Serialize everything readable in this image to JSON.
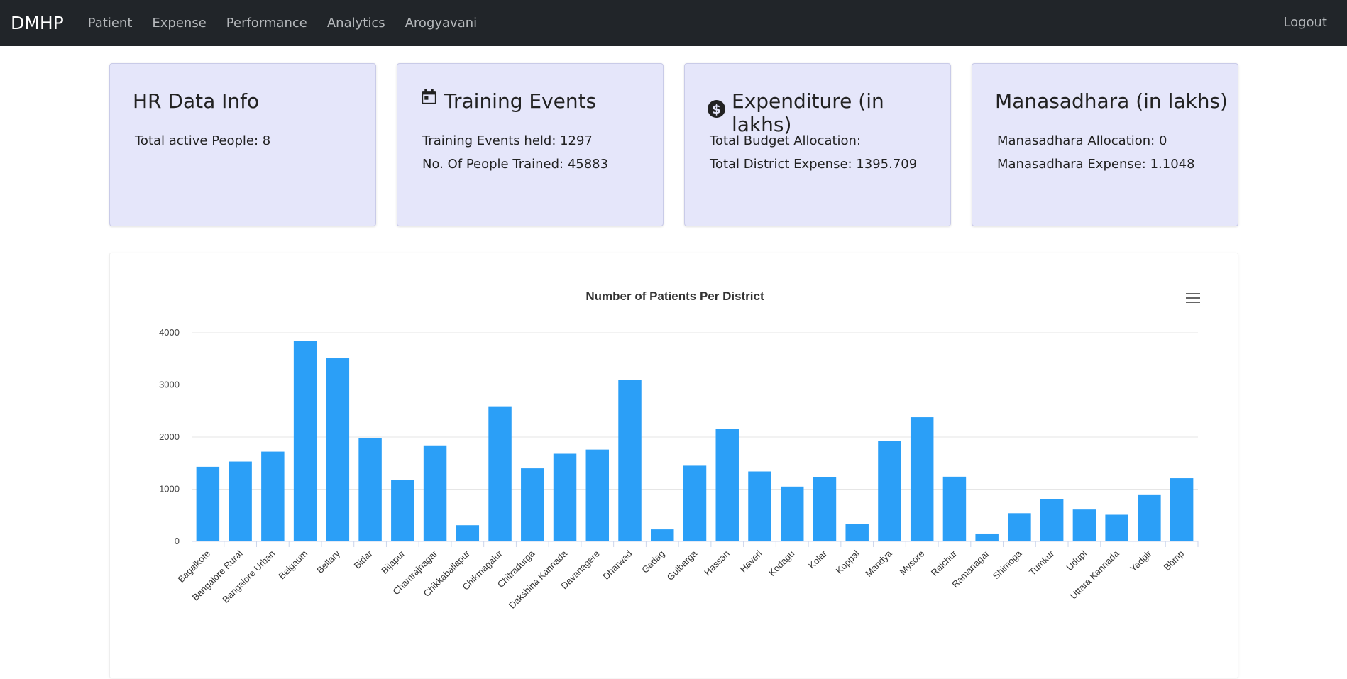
{
  "navbar": {
    "brand": "DMHP",
    "items": [
      "Patient",
      "Expense",
      "Performance",
      "Analytics",
      "Arogyavani"
    ],
    "logout": "Logout"
  },
  "cards": [
    {
      "title": "HR Data Info",
      "lines": [
        "Total active People: 8"
      ],
      "icon": ""
    },
    {
      "title": "Training Events",
      "lines": [
        "Training Events held: 1297",
        "No. Of People Trained: 45883"
      ],
      "icon": "calendar-icon"
    },
    {
      "title": "Expenditure (in lakhs)",
      "lines": [
        "Total Budget Allocation:",
        "Total District Expense: 1395.709"
      ],
      "icon": "dollar-icon"
    },
    {
      "title": "Manasadhara (in lakhs)",
      "lines": [
        "Manasadhara Allocation: 0",
        "Manasadhara Expense: 1.1048"
      ],
      "icon": ""
    }
  ],
  "colors": {
    "bar": "#2b9ff7",
    "navbar": "#212529",
    "card_bg": "#e5e6fa"
  },
  "chart_data": {
    "type": "bar",
    "title": "Number of Patients Per District",
    "menu_icon": "hamburger-menu-icon",
    "categories": [
      "Bagalkote",
      "Bangalore Rural",
      "Bangalore Urban",
      "Belgaum",
      "Bellary",
      "Bidar",
      "Bijapur",
      "Chamrajnagar",
      "Chikkaballapur",
      "Chikmagalur",
      "Chitradurga",
      "Dakshina Kannada",
      "Davanagere",
      "Dharwad",
      "Gadag",
      "Gulbarga",
      "Hassan",
      "Haveri",
      "Kodagu",
      "Kolar",
      "Koppal",
      "Mandya",
      "Mysore",
      "Raichur",
      "Ramanagar",
      "Shimoga",
      "Tumkur",
      "Udupi",
      "Uttara Kannada",
      "Yadgir",
      "Bbmp"
    ],
    "values": [
      1430,
      1530,
      1720,
      3850,
      3510,
      1980,
      1170,
      1840,
      310,
      2590,
      1400,
      1680,
      1760,
      3100,
      230,
      1450,
      2160,
      1340,
      1050,
      1230,
      340,
      1920,
      2380,
      1240,
      150,
      540,
      810,
      610,
      510,
      900,
      1210
    ],
    "ylim": [
      0,
      4000
    ],
    "yticks": [
      0,
      1000,
      2000,
      3000,
      4000
    ],
    "grid": true,
    "legend": "none"
  }
}
